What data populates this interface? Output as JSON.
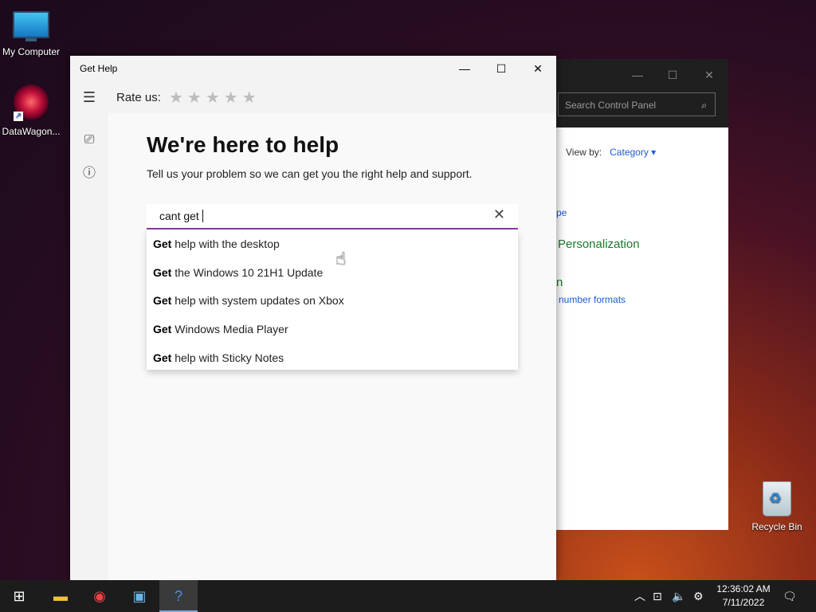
{
  "desktop": {
    "icons": [
      {
        "label": "My Computer",
        "icon": "monitor-icon"
      },
      {
        "label": "DataWagon...",
        "icon": "datawagon-icon"
      },
      {
        "label": "Recycle Bin",
        "icon": "recycle-bin-icon"
      }
    ]
  },
  "control_panel": {
    "search_placeholder": "Search Control Panel",
    "view_by_label": "View by:",
    "view_by_value": "Category",
    "partial_link_1": "pe",
    "personalization": "Personalization",
    "partial_link_2": "n",
    "number_formats": "number formats"
  },
  "get_help": {
    "window_title": "Get Help",
    "rate_label": "Rate us:",
    "stars": "★★★★★",
    "heading": "We're here to help",
    "subheading": "Tell us your problem so we can get you the right help and support.",
    "search_value": "cant get",
    "suggestions": [
      {
        "bold": "Get",
        "rest": " help with the desktop"
      },
      {
        "bold": "Get",
        "rest": " the Windows 10 21H1 Update"
      },
      {
        "bold": "Get",
        "rest": " help with system updates on Xbox"
      },
      {
        "bold": "Get",
        "rest": " Windows Media Player"
      },
      {
        "bold": "Get",
        "rest": " help with Sticky Notes"
      }
    ]
  },
  "taskbar": {
    "time": "12:36:02 AM",
    "date": "7/11/2022"
  }
}
